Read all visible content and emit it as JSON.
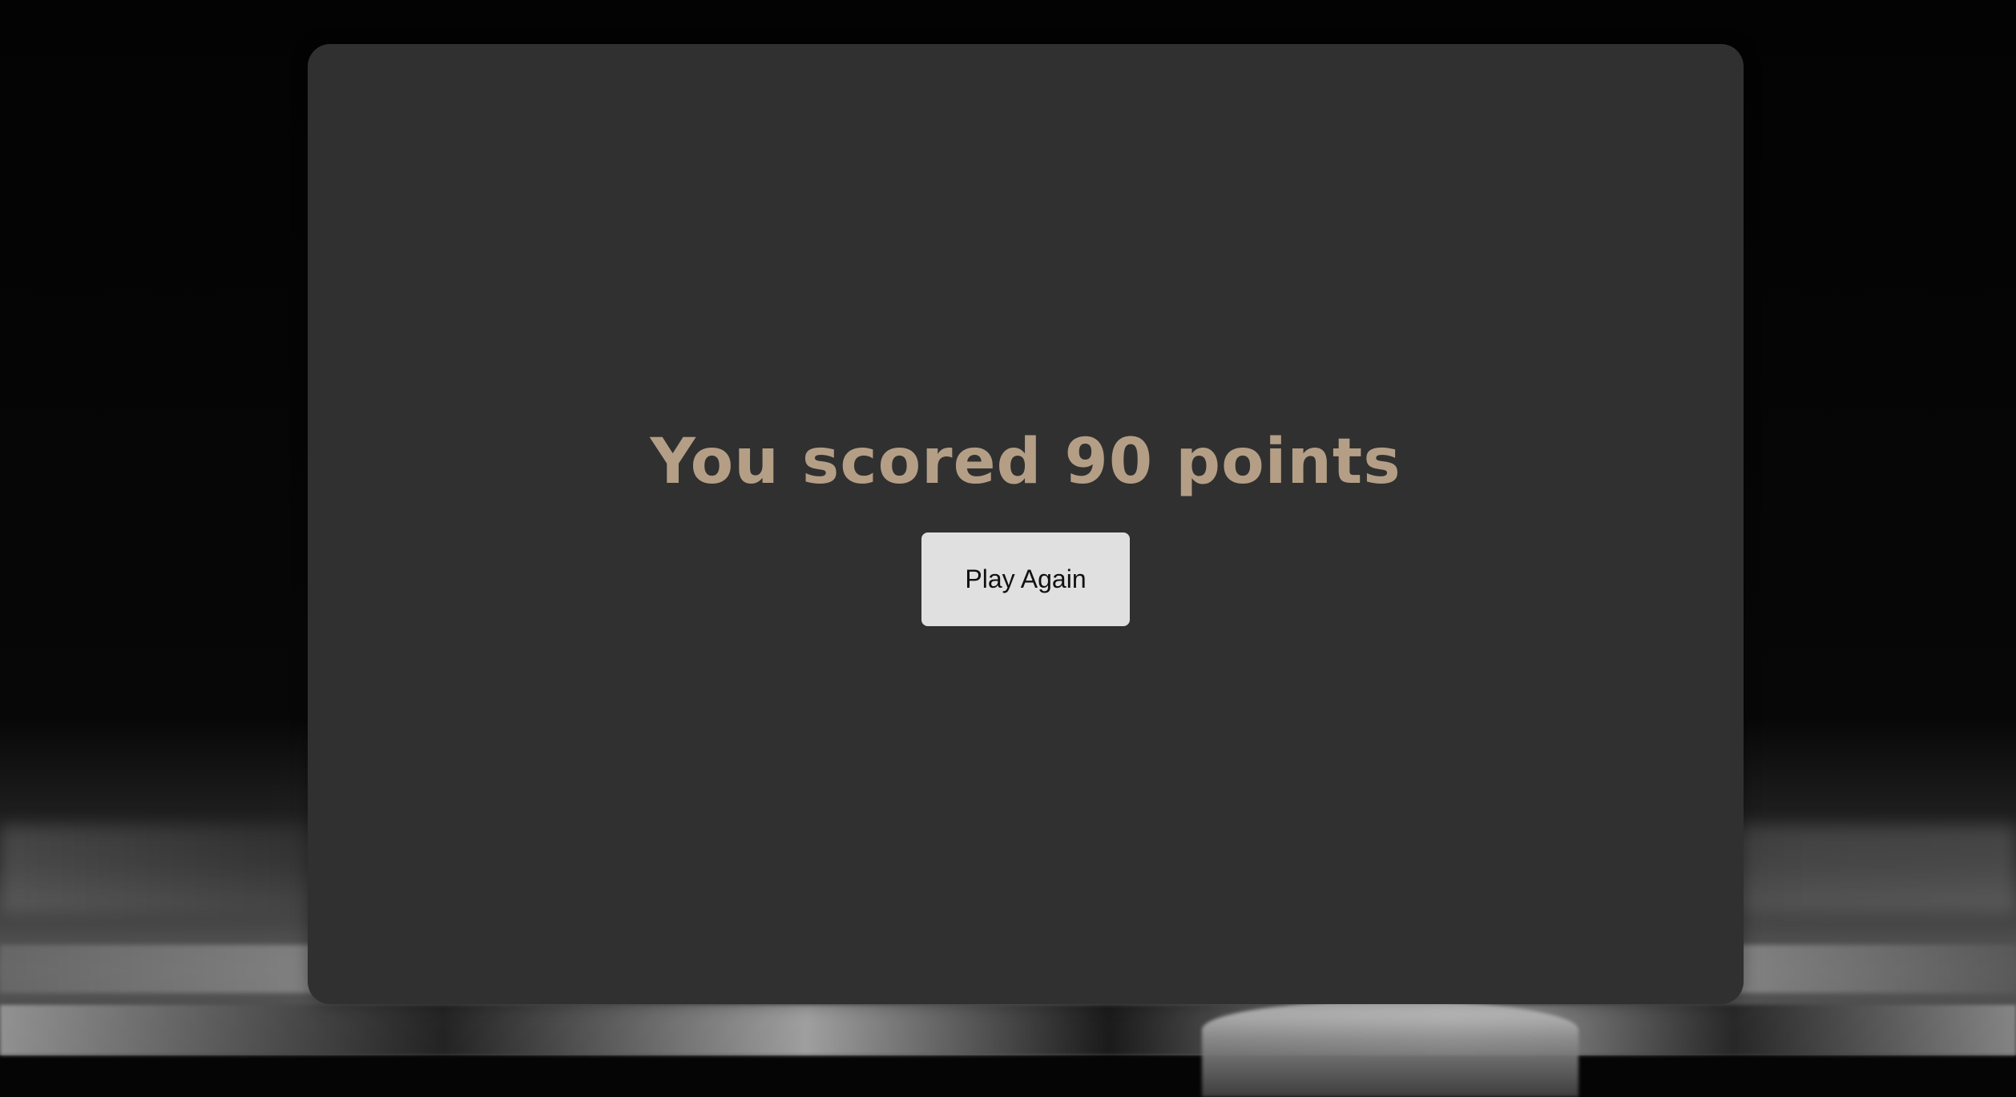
{
  "result": {
    "score_text": "You scored 90 points"
  },
  "actions": {
    "play_again_label": "Play Again"
  },
  "colors": {
    "card_background": "#303030",
    "score_text": "#b49f86",
    "button_background": "#e0e0e0",
    "button_text": "#111111"
  }
}
